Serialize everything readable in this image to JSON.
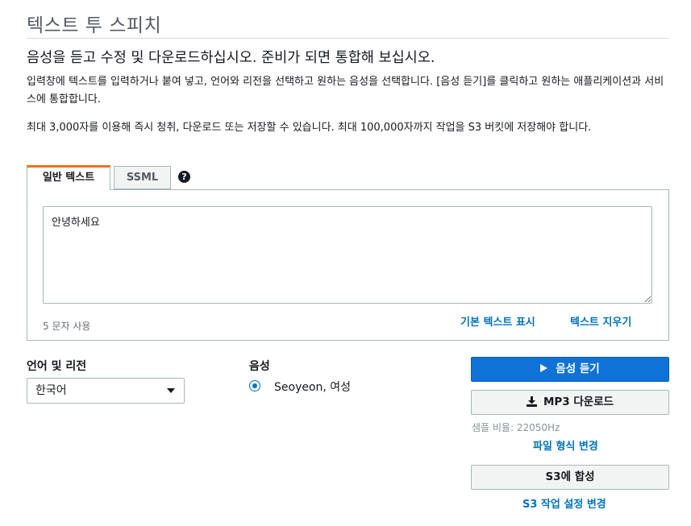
{
  "page": {
    "title": "텍스트 투 스피치",
    "subtitle": "음성을 듣고 수정 및 다운로드하십시오. 준비가 되면 통합해 보십시오.",
    "description_1": "입력창에 텍스트를 입력하거나 붙여 넣고, 언어와 리전을 선택하고 원하는 음성을 선택합니다. [음성 듣기]를 클릭하고 원하는 애플리케이션과 서비스에 통합합니다.",
    "description_2": "최대 3,000자를 이용해 즉시 청취, 다운로드 또는 저장할 수 있습니다. 최대 100,000자까지 작업을 S3 버킷에 저장해야 합니다."
  },
  "tabs": [
    {
      "label": "일반 텍스트",
      "active": true
    },
    {
      "label": "SSML",
      "active": false
    }
  ],
  "help_icon": {
    "icon": "question-circle-icon",
    "glyph": "?"
  },
  "editor": {
    "value": "안녕하세요",
    "char_count": "5 문자 사용",
    "show_default_text": "기본 텍스트 표시",
    "clear_text": "텍스트 지우기"
  },
  "language": {
    "label": "언어 및 리전",
    "selected": "한국어"
  },
  "voice": {
    "label": "음성",
    "options": [
      {
        "label": "Seoyeon, 여성",
        "selected": true
      }
    ]
  },
  "actions": {
    "listen": "음성 듣기",
    "mp3_download": "MP3 다운로드",
    "sample_rate": "샘플 비율: 22050Hz",
    "change_file_format": "파일 형식 변경",
    "synthesize_s3": "S3에 합성",
    "change_s3_settings": "S3 작업 설정 변경"
  },
  "colors": {
    "primary": "#0f72d6",
    "link": "#0073bb",
    "tab_accent": "#ec7211"
  }
}
